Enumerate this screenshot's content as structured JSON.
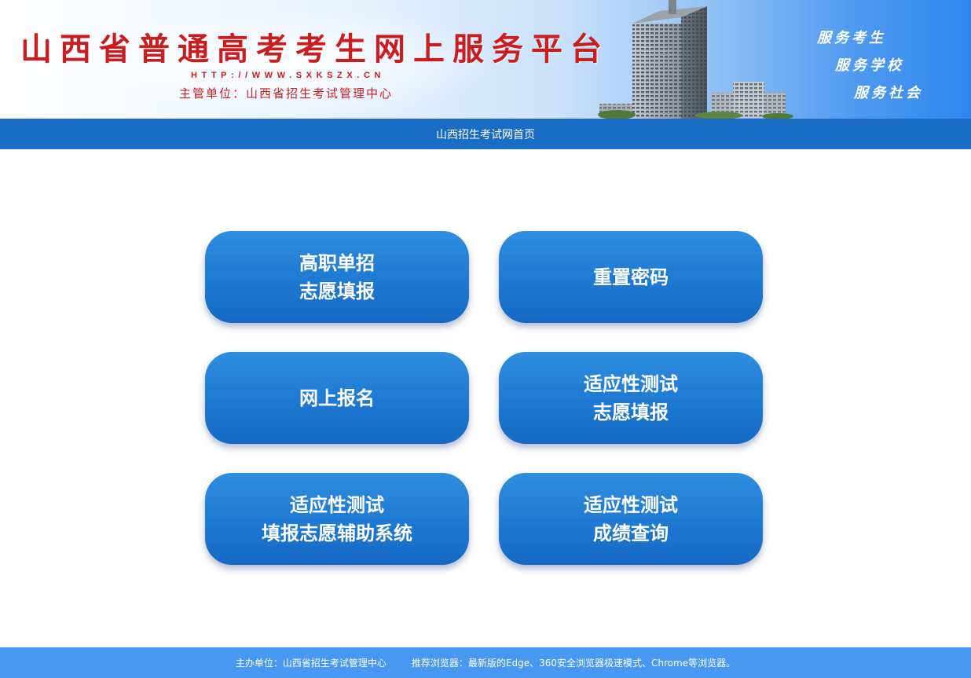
{
  "banner": {
    "title": "山西省普通高考考生网上服务平台",
    "url": "HTTP://WWW.SXKSZX.CN",
    "sponsor": "主管单位：山西省招生考试管理中心",
    "slogans": [
      "服务考生",
      "服务学校",
      "服务社会"
    ],
    "title_color": "#c81d21"
  },
  "nav": {
    "home_link": "山西招生考试网首页",
    "bar_color": "#1a6cc4"
  },
  "tiles": [
    {
      "lines": [
        "高职单招",
        "志愿填报"
      ]
    },
    {
      "lines": [
        "重置密码"
      ]
    },
    {
      "lines": [
        "网上报名"
      ]
    },
    {
      "lines": [
        "适应性测试",
        "志愿填报"
      ]
    },
    {
      "lines": [
        "适应性测试",
        "填报志愿辅助系统"
      ]
    },
    {
      "lines": [
        "适应性测试",
        "成绩查询"
      ]
    }
  ],
  "tile_color": "#1e79d2",
  "footer": {
    "organizer": "主办单位：山西省招生考试管理中心",
    "browser_note": "推荐浏览器：最新版的Edge、360安全浏览器极速模式、Chrome等浏览器。",
    "bar_color": "#4898f3"
  }
}
